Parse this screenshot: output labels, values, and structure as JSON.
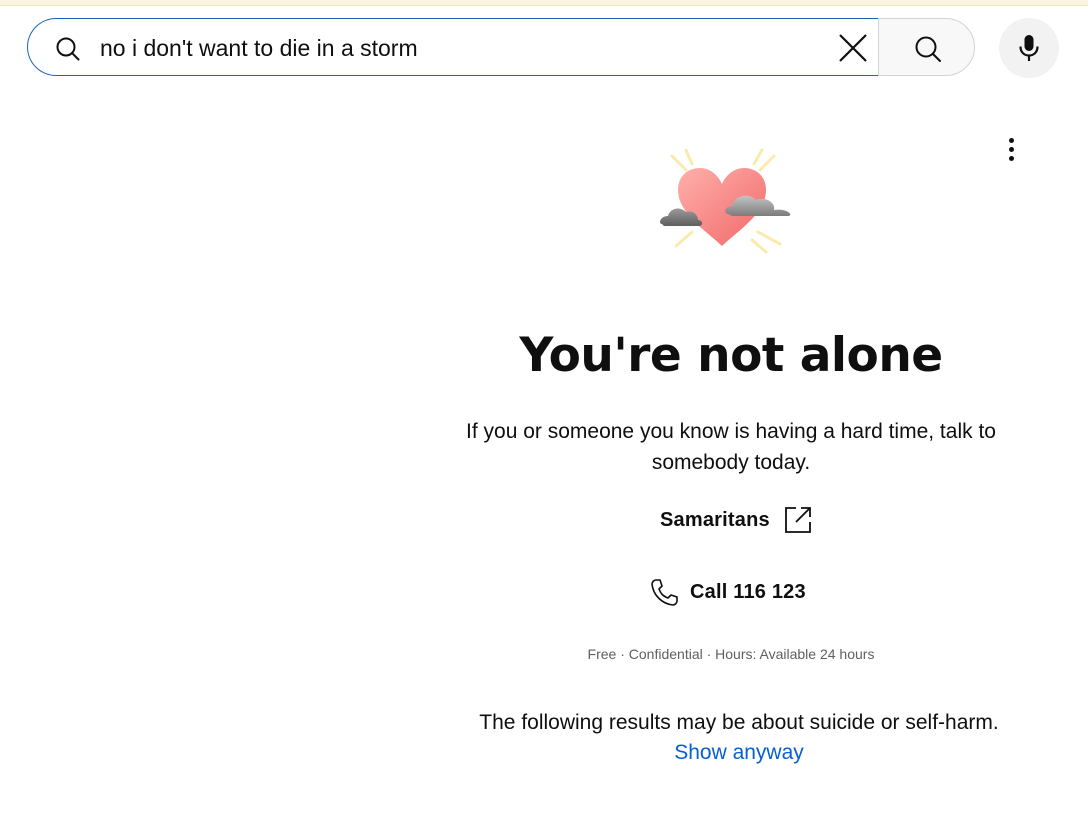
{
  "search": {
    "query": "no i don't want to die in a storm"
  },
  "crisis_panel": {
    "title": "You're not alone",
    "description": "If you or someone you know is having a hard time, talk to somebody today.",
    "hotline_name": "Samaritans",
    "call_label": "Call 116 123",
    "meta": "Free · Confidential · Hours: Available 24 hours",
    "warning": "The following results may be about suicide or self-harm.",
    "show_anyway": "Show anyway"
  },
  "icons": {
    "search": "search-icon",
    "clear": "close-icon",
    "submit": "search-icon",
    "mic": "mic-icon",
    "more": "more-vert-icon",
    "external": "external-link-icon",
    "phone": "phone-icon",
    "illustration": "heart-clouds-illustration"
  },
  "colors": {
    "focus_border": "#1c62b9",
    "link": "#065fd4",
    "heart": "#f47d7d",
    "text": "#0f0f0f",
    "meta_text": "#606060"
  }
}
